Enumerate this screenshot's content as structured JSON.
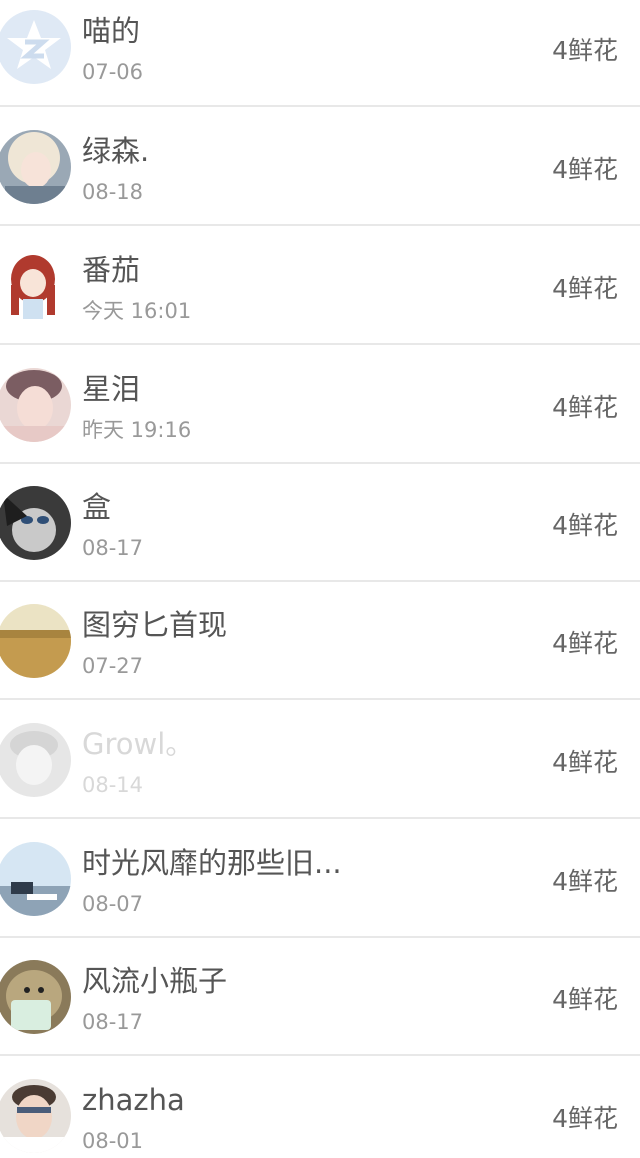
{
  "list": {
    "items": [
      {
        "name": "喵的",
        "time": "07-06",
        "gift": "4鲜花",
        "avatar": "qq-star-avatar",
        "dimmed": false
      },
      {
        "name": "绿森.",
        "time": "08-18",
        "gift": "4鲜花",
        "avatar": "blonde-girl-avatar",
        "dimmed": false
      },
      {
        "name": "番茄",
        "time": "今天 16:01",
        "gift": "4鲜花",
        "avatar": "anime-girl-avatar",
        "dimmed": false
      },
      {
        "name": "星泪",
        "time": "昨天 19:16",
        "gift": "4鲜花",
        "avatar": "young-man-avatar",
        "dimmed": false
      },
      {
        "name": "盒",
        "time": "08-17",
        "gift": "4鲜花",
        "avatar": "dark-anime-avatar",
        "dimmed": false
      },
      {
        "name": "图穷匕首现",
        "time": "07-27",
        "gift": "4鲜花",
        "avatar": "wheat-field-avatar",
        "dimmed": false
      },
      {
        "name": "Growl。",
        "time": "08-14",
        "gift": "4鲜花",
        "avatar": "faded-person-avatar",
        "dimmed": true
      },
      {
        "name": "时光风靡的那些旧...",
        "time": "08-07",
        "gift": "4鲜花",
        "avatar": "sky-scene-avatar",
        "dimmed": false
      },
      {
        "name": "风流小瓶子",
        "time": "08-17",
        "gift": "4鲜花",
        "avatar": "hedgehog-avatar",
        "dimmed": false
      },
      {
        "name": "zhazha",
        "time": "08-01",
        "gift": "4鲜花",
        "avatar": "glasses-man-avatar",
        "dimmed": false
      }
    ]
  }
}
